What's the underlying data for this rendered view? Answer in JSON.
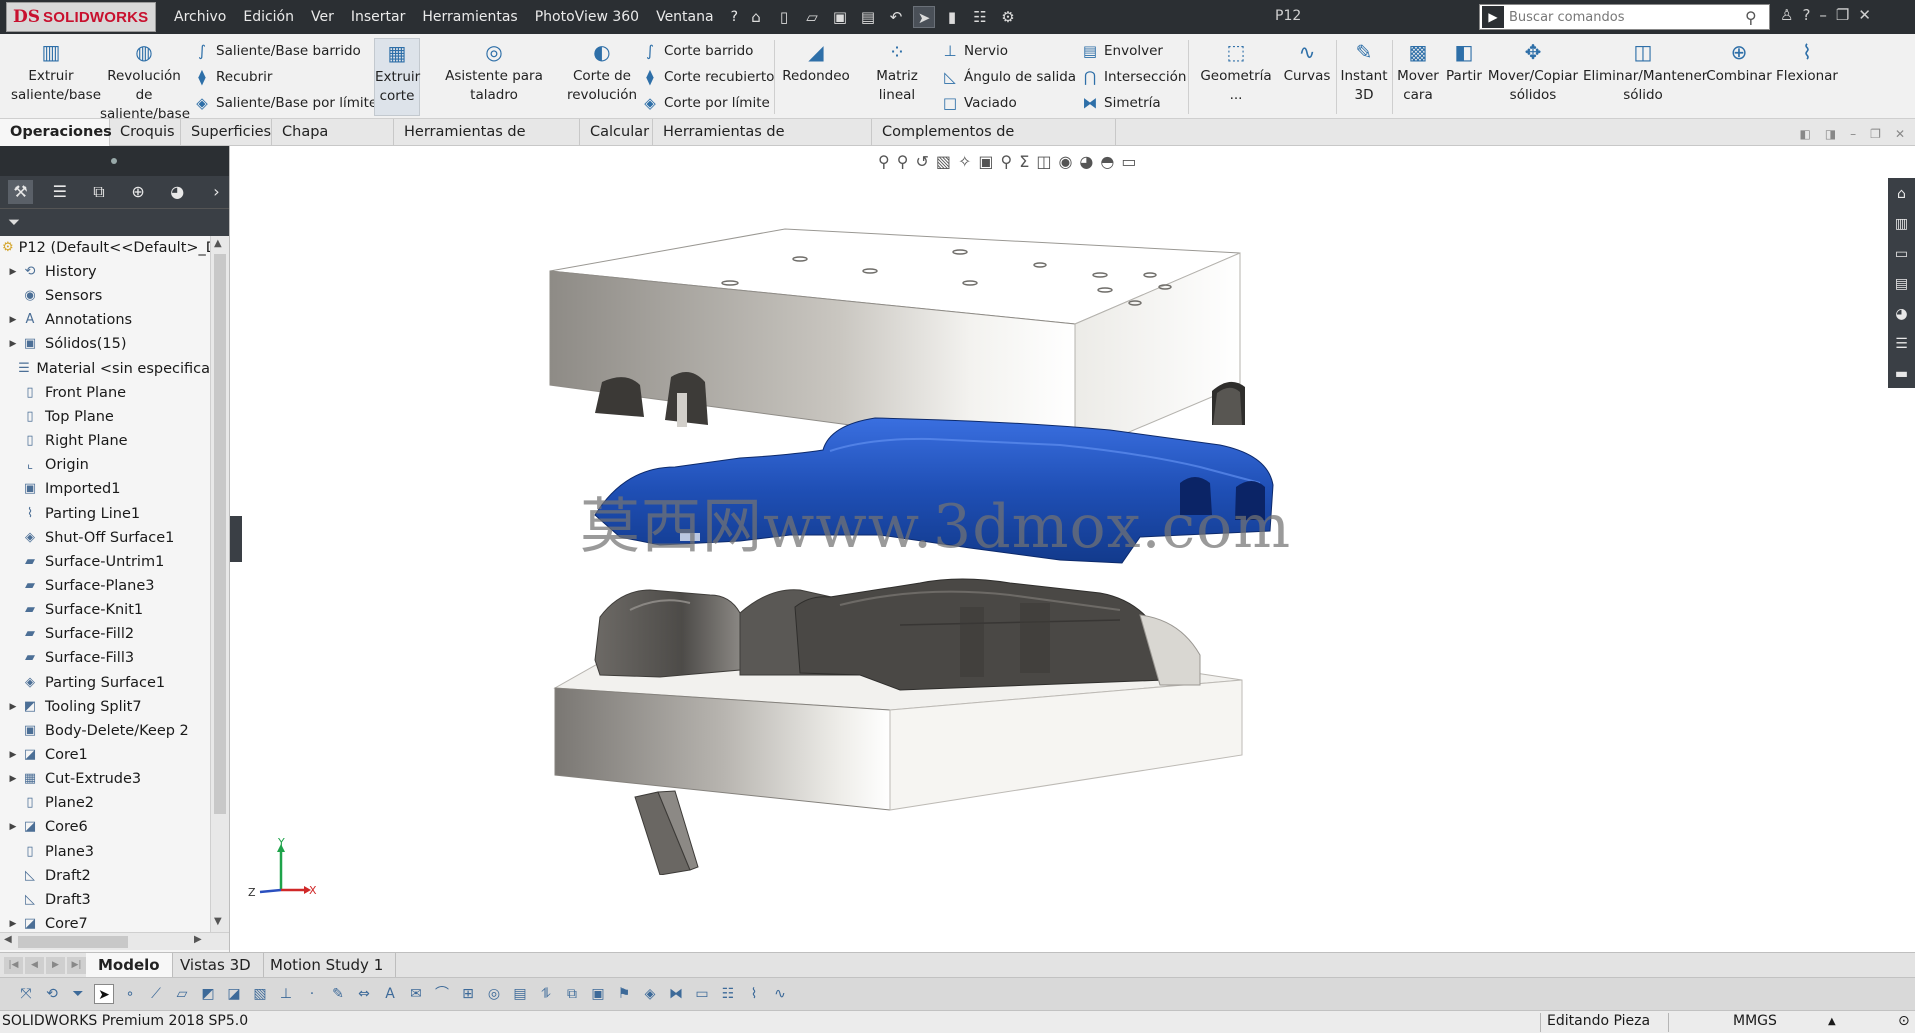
{
  "app": {
    "logo_mark": "DS",
    "logo_text": "SOLIDWORKS",
    "document_title": "P12",
    "search_placeholder": "Buscar comandos"
  },
  "menu": [
    "Archivo",
    "Edición",
    "Ver",
    "Insertar",
    "Herramientas",
    "PhotoView 360",
    "Ventana",
    "?"
  ],
  "command_manager": {
    "extrude_boss": "Extruir saliente/base",
    "revolve_boss": "Revolución de saliente/base",
    "swept_boss": "Saliente/Base barrido",
    "loft_boss": "Recubrir",
    "boundary_boss": "Saliente/Base por límite",
    "extrude_cut": "Extruir corte",
    "hole_wizard": "Asistente para taladro",
    "revolve_cut": "Corte de revolución",
    "swept_cut": "Corte barrido",
    "loft_cut": "Corte recubierto",
    "boundary_cut": "Corte por límite",
    "fillet": "Redondeo",
    "linear_pattern": "Matriz lineal",
    "rib": "Nervio",
    "draft": "Ángulo de salida",
    "shell": "Vaciado",
    "wrap": "Envolver",
    "intersect": "Intersección",
    "mirror": "Simetría",
    "geometry": "Geometría ...",
    "curves": "Curvas",
    "instant3d": "Instant 3D",
    "move_face": "Mover cara",
    "split": "Partir",
    "move_copy": "Mover/Copiar sólidos",
    "delete_keep": "Eliminar/Mantener sólido",
    "combine": "Combinar",
    "flex": "Flexionar"
  },
  "tabs": [
    "Operaciones",
    "Croquis",
    "Superficies",
    "Chapa metálica",
    "Herramientas de moldes",
    "Calcular",
    "Herramientas de renderizado",
    "Complementos de SOLIDWORKS"
  ],
  "tree": {
    "root": "P12  (Default<<Default>_D",
    "items": [
      {
        "label": "History",
        "icon": "history-icon",
        "expand": true
      },
      {
        "label": "Sensors",
        "icon": "sensor-icon",
        "expand": false
      },
      {
        "label": "Annotations",
        "icon": "annotation-icon",
        "expand": true
      },
      {
        "label": "Sólidos(15)",
        "icon": "solid-bodies-icon",
        "expand": true
      },
      {
        "label": "Material <sin especifica",
        "icon": "material-icon",
        "expand": false
      },
      {
        "label": "Front Plane",
        "icon": "plane-icon",
        "expand": false
      },
      {
        "label": "Top Plane",
        "icon": "plane-icon",
        "expand": false
      },
      {
        "label": "Right Plane",
        "icon": "plane-icon",
        "expand": false
      },
      {
        "label": "Origin",
        "icon": "origin-icon",
        "expand": false
      },
      {
        "label": "Imported1",
        "icon": "imported-icon",
        "expand": false
      },
      {
        "label": "Parting Line1",
        "icon": "parting-line-icon",
        "expand": false
      },
      {
        "label": "Shut-Off Surface1",
        "icon": "shutoff-surface-icon",
        "expand": false
      },
      {
        "label": "Surface-Untrim1",
        "icon": "surface-icon",
        "expand": false
      },
      {
        "label": "Surface-Plane3",
        "icon": "surface-icon",
        "expand": false
      },
      {
        "label": "Surface-Knit1",
        "icon": "surface-icon",
        "expand": false
      },
      {
        "label": "Surface-Fill2",
        "icon": "surface-icon",
        "expand": false
      },
      {
        "label": "Surface-Fill3",
        "icon": "surface-icon",
        "expand": false
      },
      {
        "label": "Parting Surface1",
        "icon": "parting-surface-icon",
        "expand": false
      },
      {
        "label": "Tooling Split7",
        "icon": "tooling-split-icon",
        "expand": true
      },
      {
        "label": "Body-Delete/Keep 2",
        "icon": "body-delete-icon",
        "expand": false
      },
      {
        "label": "Core1",
        "icon": "core-icon",
        "expand": true
      },
      {
        "label": "Cut-Extrude3",
        "icon": "cut-extrude-icon",
        "expand": true
      },
      {
        "label": "Plane2",
        "icon": "plane-icon",
        "expand": false
      },
      {
        "label": "Core6",
        "icon": "core-icon",
        "expand": true
      },
      {
        "label": "Plane3",
        "icon": "plane-icon",
        "expand": false
      },
      {
        "label": "Draft2",
        "icon": "draft-icon",
        "expand": false
      },
      {
        "label": "Draft3",
        "icon": "draft-icon",
        "expand": false
      },
      {
        "label": "Core7",
        "icon": "core-icon",
        "expand": true
      }
    ]
  },
  "viewport": {
    "watermark": "莫西网www.3dmox.com",
    "triad": {
      "y": "Y",
      "z": "Z",
      "x": "X"
    }
  },
  "bottom_tabs": [
    "Modelo",
    "Vistas 3D",
    "Motion Study 1"
  ],
  "status": {
    "product": "SOLIDWORKS Premium 2018 SP5.0",
    "mode": "Editando Pieza",
    "units": "MMGS"
  },
  "colors": {
    "titlebar": "#2b2f33",
    "core_blue": "#1f4fb5",
    "mold_gray": "#d8d6d2"
  }
}
